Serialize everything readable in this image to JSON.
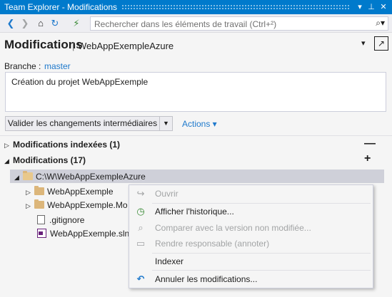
{
  "window": {
    "title": "Team Explorer - Modifications"
  },
  "toolbar": {
    "search_placeholder": "Rechercher dans les éléments de travail (Ctrl+²)"
  },
  "header": {
    "title": "Modifications",
    "separator": "|",
    "repo": "WebAppExempleAzure"
  },
  "branch": {
    "label": "Branche :",
    "name": "master"
  },
  "commit_message": "Création du projet WebAppExemple",
  "commit_button": "Valider les changements intermédiaires",
  "actions_link": "Actions ▾",
  "sections": {
    "staged": {
      "label": "Modifications indexées (1)",
      "action": "—"
    },
    "changes": {
      "label": "Modifications (17)",
      "action": "+"
    }
  },
  "tree": {
    "root": "C:\\W\\WebAppExempleAzure",
    "items": [
      {
        "label": "WebAppExemple"
      },
      {
        "label": "WebAppExemple.Mo"
      },
      {
        "label": ".gitignore"
      },
      {
        "label": "WebAppExemple.sln"
      }
    ]
  },
  "context_menu": {
    "items": [
      {
        "label": "Ouvrir",
        "icon": "redo-arrow-icon",
        "enabled": false
      },
      {
        "label": "Afficher l'historique...",
        "icon": "history-icon",
        "enabled": true
      },
      {
        "label": "Comparer avec la version non modifiée...",
        "icon": "compare-icon",
        "enabled": false
      },
      {
        "label": "Rendre responsable (annoter)",
        "icon": "annotate-icon",
        "enabled": false
      },
      {
        "label": "Indexer",
        "icon": "",
        "enabled": true
      },
      {
        "label": "Annuler les modifications...",
        "icon": "undo-icon",
        "enabled": true
      }
    ]
  },
  "colors": {
    "accent": "#007acc",
    "link": "#1e79cc",
    "selection": "#cfd0d9",
    "history": "#388a34",
    "undo": "#1e79cc"
  }
}
